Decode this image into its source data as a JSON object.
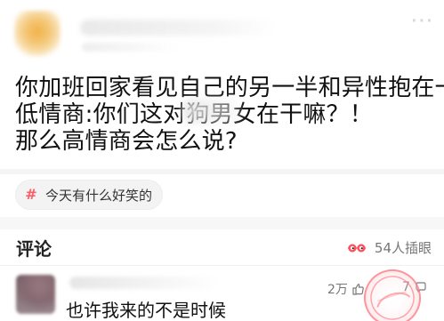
{
  "post": {
    "lines": [
      "你加班回家看见自己的另一半和异性抱在一起",
      "低情商:你们这对狗男女在干嘛？！",
      "那么高情商会怎么说?"
    ]
  },
  "topic": {
    "icon": "hash-icon",
    "label": "今天有什么好笑的",
    "accent_color": "#ff5a66"
  },
  "comments": {
    "title": "评论",
    "participants_label": "54人插眼",
    "participants_icon": "eyes-icon",
    "items": [
      {
        "text": "也许我来的不是时候",
        "likes": "2万",
        "replies": "7",
        "like_icon": "thumb-up-icon",
        "reply_icon": "comment-icon"
      }
    ]
  },
  "watermark": {
    "text": "神评"
  },
  "header": {
    "more_icon": "more-icon"
  }
}
